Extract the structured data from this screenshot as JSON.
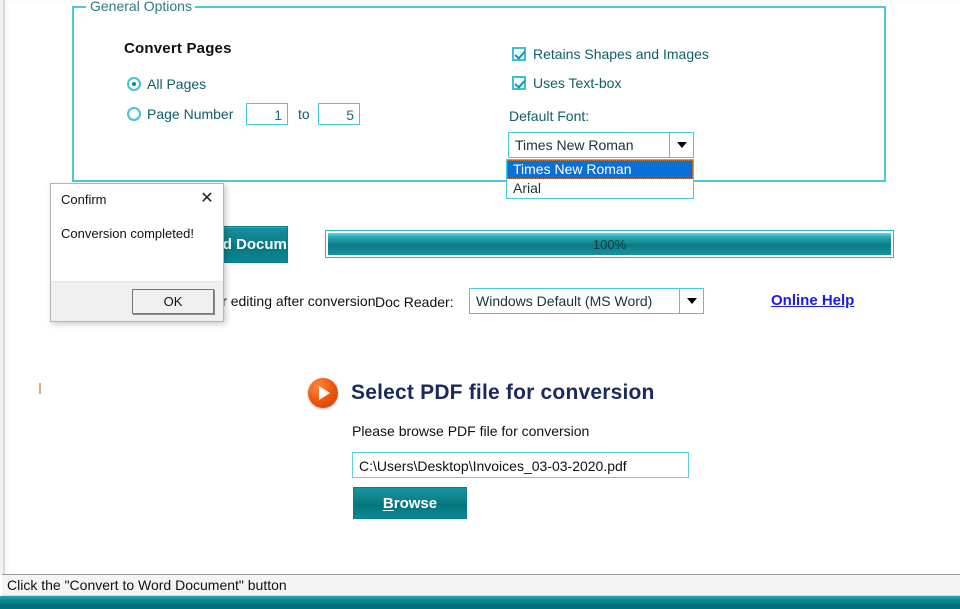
{
  "group": {
    "legend": "General Options",
    "convert_pages_title": "Convert Pages",
    "radios": [
      {
        "label": "All Pages",
        "checked": true
      },
      {
        "label": "Page Number",
        "checked": false
      }
    ],
    "page_from": "1",
    "to_label": "to",
    "page_to": "5",
    "checkboxes": [
      {
        "label": "Retains Shapes and Images",
        "checked": true
      },
      {
        "label": "Uses Text-box",
        "checked": true
      }
    ],
    "default_font_label": "Default Font:",
    "default_font_value": "Times New Roman",
    "font_options": [
      {
        "label": "Times New Roman",
        "selected": true
      },
      {
        "label": "Arial",
        "selected": false
      }
    ]
  },
  "actions": {
    "convert_button": "Convert to Word Document",
    "convert_button_visible_fragment": "ument",
    "open_after_label": "Open document for editing after conversion",
    "open_after_visible_fragment": "diting after conversion",
    "progress_percent": "100%",
    "doc_reader_label": "Doc Reader:",
    "doc_reader_value": "Windows Default (MS Word)",
    "online_help": "Online Help"
  },
  "select_section": {
    "heading": "Select PDF file for conversion",
    "subtitle": "Please browse PDF file for conversion",
    "file_path": "C:\\Users\\Desktop\\Invoices_03-03-2020.pdf",
    "browse_button": "Browse",
    "browse_accel": "B",
    "browse_rest": "rowse",
    "icon": "play-circle-icon"
  },
  "dialog": {
    "title": "Confirm",
    "close_icon": "✕",
    "message": "Conversion completed!",
    "ok_button": "OK"
  },
  "statusbar": {
    "text": "Click the \"Convert to Word Document\" button"
  },
  "colors": {
    "accent_teal": "#0b7e88",
    "border_cyan": "#4ec8d8",
    "label_teal": "#0f5e68",
    "heading_navy": "#1a2a5e",
    "link_blue": "#1a1aee",
    "highlight_blue": "#0a6fd6",
    "icon_orange": "#ee5a14"
  }
}
